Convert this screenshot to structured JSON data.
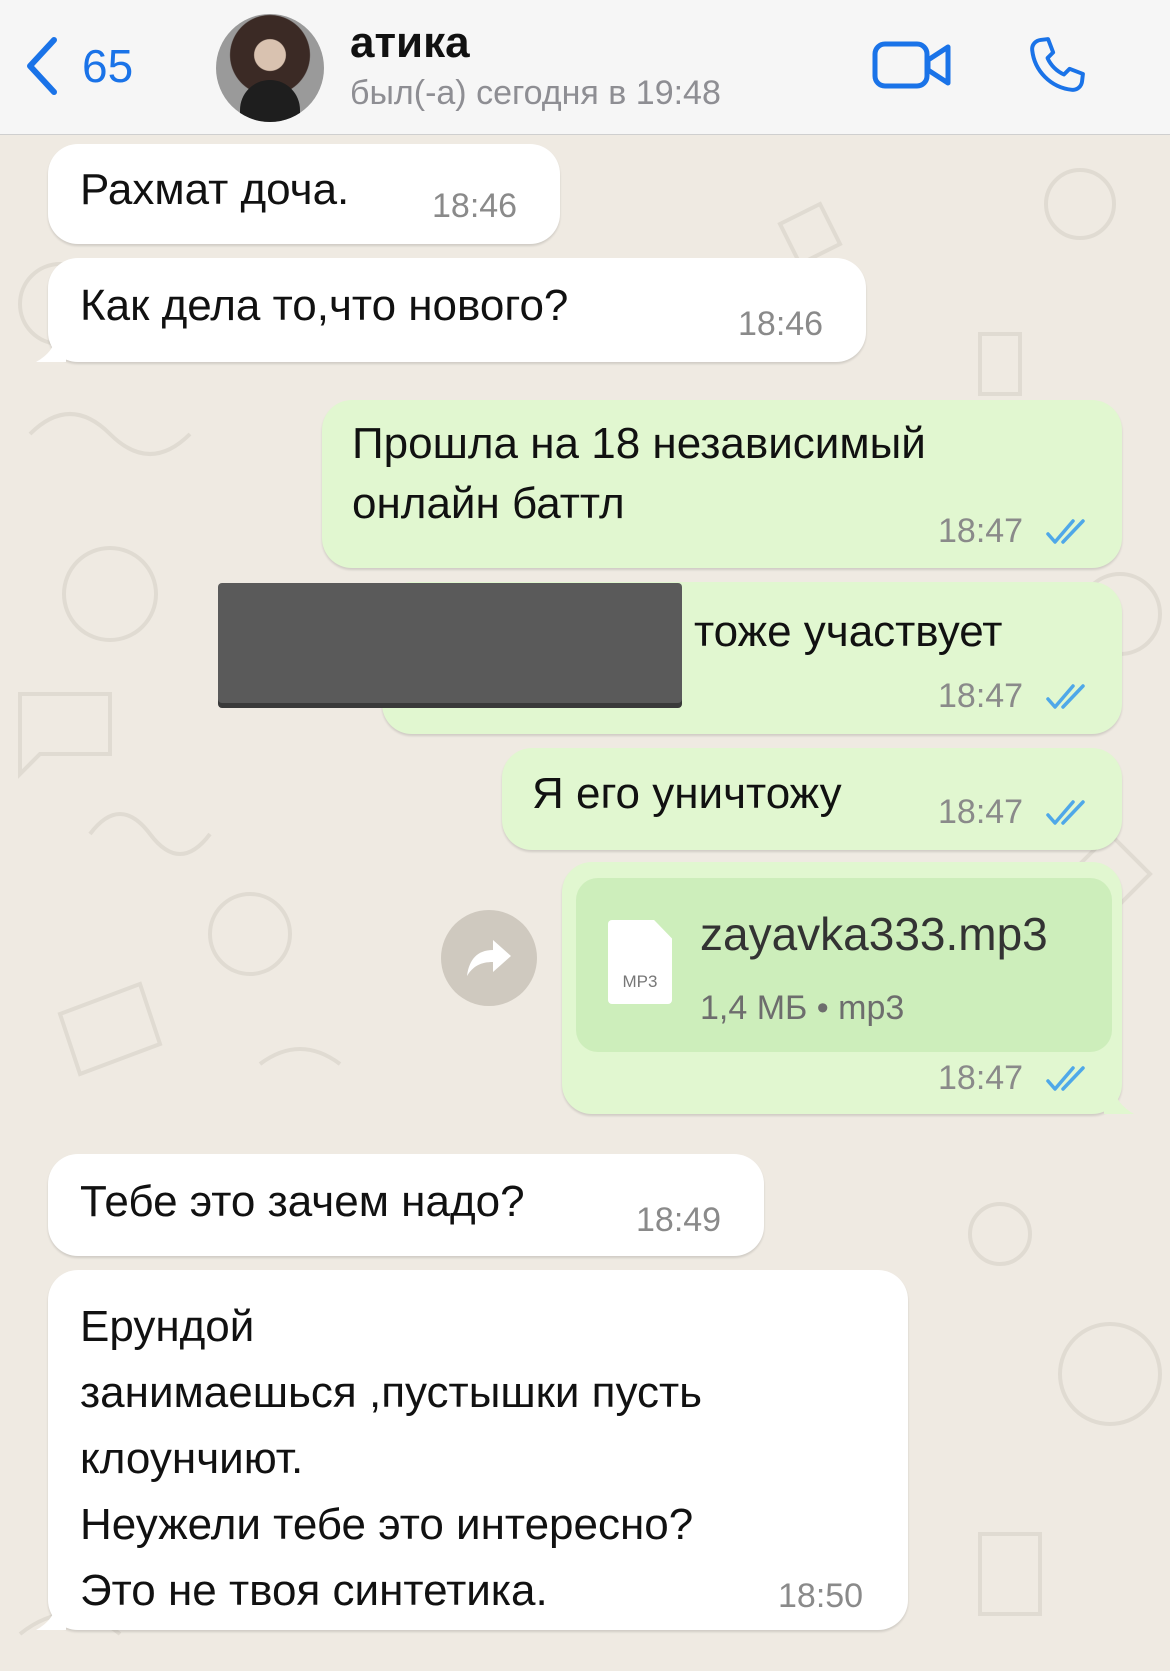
{
  "header": {
    "back_count": "65",
    "contact_name": "атика",
    "last_seen": "был(-а) сегодня в 19:48"
  },
  "colors": {
    "accent": "#1a73e8",
    "incoming_bubble": "#ffffff",
    "outgoing_bubble": "#e1f7d0",
    "file_card": "#cdeebb",
    "read_ticks": "#4fa8e8",
    "background": "#efeae2"
  },
  "icons": {
    "back": "chevron-left-icon",
    "video": "video-camera-icon",
    "call": "phone-icon",
    "forward": "forward-arrow-icon",
    "read": "double-check-icon"
  },
  "messages": [
    {
      "direction": "incoming",
      "text": "Рахмат доча.",
      "time": "18:46"
    },
    {
      "direction": "incoming",
      "text": "Как дела то,что нового?",
      "time": "18:46"
    },
    {
      "direction": "outgoing",
      "text": "Прошла на 18 независимый\nонлайн баттл",
      "time": "18:47",
      "status": "read"
    },
    {
      "direction": "outgoing",
      "text": "тоже участвует",
      "time": "18:47",
      "status": "read",
      "redacted_prefix": true
    },
    {
      "direction": "outgoing",
      "text": "Я его уничтожу",
      "time": "18:47",
      "status": "read"
    },
    {
      "direction": "outgoing",
      "type": "file",
      "file_icon_label": "MP3",
      "file_name": "zayavka333.mp3",
      "file_meta": "1,4 МБ • mp3",
      "time": "18:47",
      "status": "read"
    },
    {
      "direction": "incoming",
      "text": "Тебе это зачем надо?",
      "time": "18:49"
    },
    {
      "direction": "incoming",
      "text": "Ерундой\nзанимаешься ,пустышки пусть\nклоунчиют.\nНеужели тебе это интересно?\nЭто не твоя синтетика.",
      "time": "18:50"
    }
  ]
}
